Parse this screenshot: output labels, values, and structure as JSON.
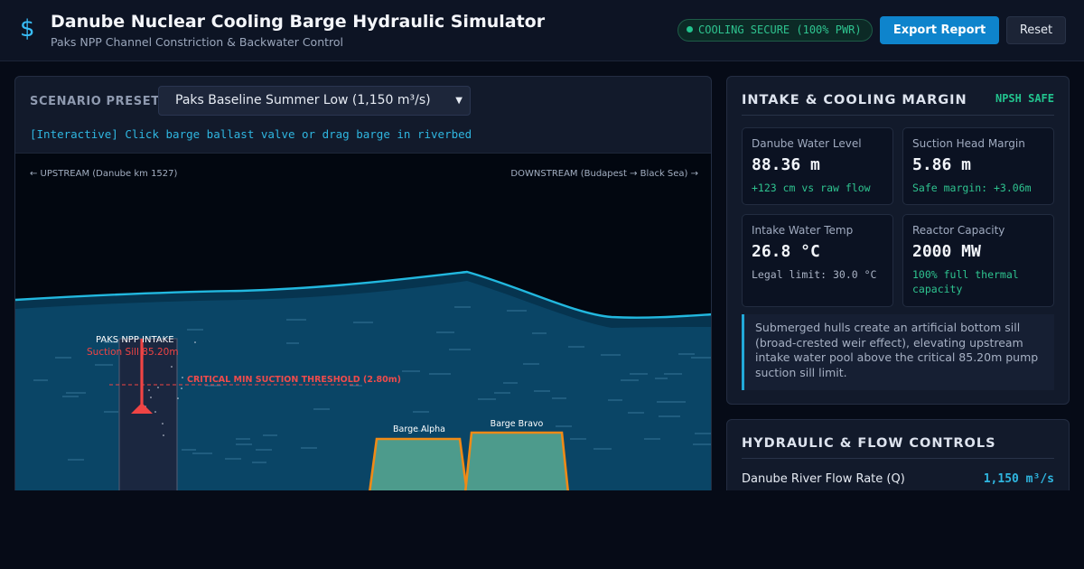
{
  "header": {
    "logo_glyph": "$",
    "title": "Danube Nuclear Cooling Barge Hydraulic Simulator",
    "subtitle": "Paks NPP Channel Constriction & Backwater Control",
    "status": "COOLING SECURE (100% PWR)",
    "status_color": "#22c38e",
    "export_label": "Export Report",
    "reset_label": "Reset"
  },
  "simulator": {
    "preset_label": "SCENARIO PRESET:",
    "preset_value": "Paks Baseline Summer Low (1,150 m³/s)",
    "hint": "[Interactive] Click barge ballast valve or drag barge in riverbed",
    "upstream_label": "← UPSTREAM (Danube km 1527)",
    "downstream_label": "DOWNSTREAM (Budapest → Black Sea) →",
    "intake_title": "PAKS NPP INTAKE",
    "intake_sill": "Suction Sill 85.20m",
    "threshold_label": "CRITICAL MIN SUCTION THRESHOLD (2.80m)",
    "barges": [
      {
        "name": "Barge Alpha"
      },
      {
        "name": "Barge Bravo"
      }
    ],
    "colors": {
      "water": "#0a4566",
      "surface": "#22b8df",
      "barge_fill": "#4d9b8c",
      "barge_stroke": "#f08a16",
      "alert": "#f04444"
    }
  },
  "margin": {
    "title": "INTAKE & COOLING MARGIN",
    "badge": "NPSH SAFE",
    "stats": [
      {
        "label": "Danube Water Level",
        "value": "88.36 m",
        "note": "+123 cm vs raw flow",
        "tone": "green"
      },
      {
        "label": "Suction Head Margin",
        "value": "5.86 m",
        "note": "Safe margin: +3.06m",
        "tone": "green"
      },
      {
        "label": "Intake Water Temp",
        "value": "26.8 °C",
        "note": "Legal limit: 30.0 °C",
        "tone": "grey"
      },
      {
        "label": "Reactor Capacity",
        "value": "2000 MW",
        "note": "100% full thermal capacity",
        "tone": "green"
      }
    ],
    "info": "Submerged hulls create an artificial bottom sill (broad-crested weir effect), elevating upstream intake water pool above the critical 85.20m pump suction sill limit."
  },
  "controls": {
    "title": "HYDRAULIC & FLOW CONTROLS",
    "flow_label": "Danube River Flow Rate (Q)",
    "flow_value": "1,150 m³/s"
  }
}
